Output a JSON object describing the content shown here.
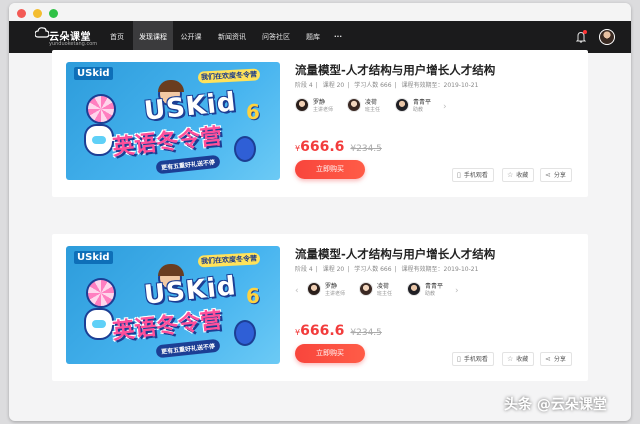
{
  "nav": {
    "brand": "云朵课堂",
    "domain": "yunduoketang.com",
    "items": [
      "首页",
      "发现课程",
      "公开课",
      "新闻资讯",
      "问答社区",
      "题库",
      "···"
    ],
    "active_index": 1
  },
  "banner": {
    "brand_tag": "USkid",
    "slogan": "我们在欢度冬令营",
    "headline": "USKid",
    "cn_title": "英语冬令营",
    "gift_text": "更有五重好礼送不停",
    "number": "6"
  },
  "courses": [
    {
      "title": "流量模型-人才结构与用户增长人才结构",
      "meta": [
        "阶段 4",
        "课程 20",
        "学习人数 666",
        "课程有效期至：2019-10-21"
      ],
      "teachers": [
        {
          "name": "罗静",
          "role": "主讲老师"
        },
        {
          "name": "凌荷",
          "role": "班主任"
        },
        {
          "name": "青青平",
          "role": "助教"
        }
      ],
      "price_symbol": "¥",
      "price": "666.6",
      "original_price": "¥234.5",
      "buy_label": "立即购买",
      "actions": [
        "手机观看",
        "收藏",
        "分享"
      ]
    },
    {
      "title": "流量模型-人才结构与用户增长人才结构",
      "meta": [
        "阶段 4",
        "课程 20",
        "学习人数 666",
        "课程有效期至：2019-10-21"
      ],
      "teachers": [
        {
          "name": "罗静",
          "role": "主讲老师"
        },
        {
          "name": "凌荷",
          "role": "班主任"
        },
        {
          "name": "青青平",
          "role": "助教"
        }
      ],
      "price_symbol": "¥",
      "price": "666.6",
      "original_price": "¥234.5",
      "buy_label": "立即购买",
      "actions": [
        "手机观看",
        "收藏",
        "分享"
      ]
    }
  ],
  "watermark": "头条 @云朵课堂",
  "colors": {
    "accent": "#f23c3c",
    "nav_bg": "#1b1b1c",
    "banner": "#47b4ef"
  }
}
